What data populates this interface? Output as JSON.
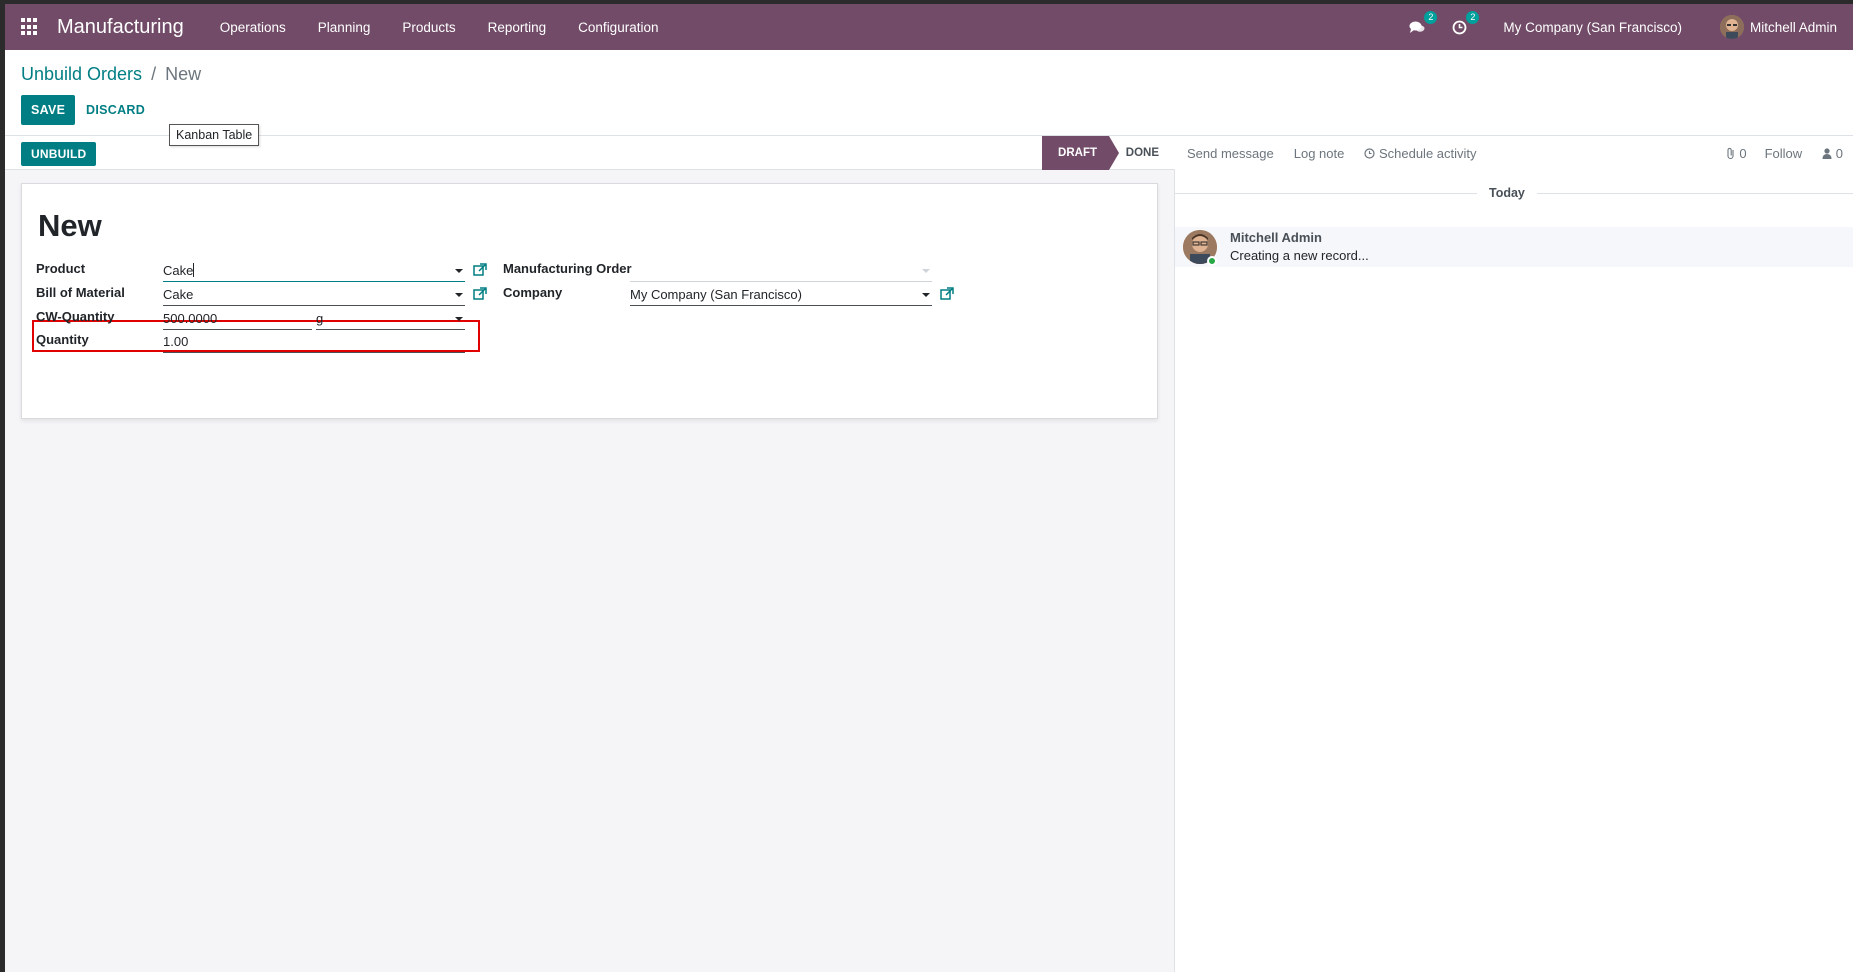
{
  "navbar": {
    "app_name": "Manufacturing",
    "menu": [
      "Operations",
      "Planning",
      "Products",
      "Reporting",
      "Configuration"
    ],
    "messages_badge": "2",
    "activities_badge": "2",
    "company": "My Company (San Francisco)",
    "user": "Mitchell Admin",
    "color": "#714B67"
  },
  "breadcrumb": {
    "parent": "Unbuild Orders",
    "separator": "/",
    "current": "New"
  },
  "buttons": {
    "save": "SAVE",
    "discard": "DISCARD",
    "unbuild": "UNBUILD"
  },
  "tooltip": "Kanban Table",
  "statusbar": {
    "stages": [
      "DRAFT",
      "DONE"
    ],
    "active": "DRAFT"
  },
  "form": {
    "title": "New",
    "product_label": "Product",
    "product_value": "Cake",
    "bom_label": "Bill of Material",
    "bom_value": "Cake",
    "cw_label": "CW-Quantity",
    "cw_value": "500.0000",
    "cw_uom": "g",
    "qty_label": "Quantity",
    "qty_value": "1.00",
    "mo_label": "Manufacturing Order",
    "mo_value": "",
    "company_label": "Company",
    "company_value": "My Company (San Francisco)"
  },
  "chatter": {
    "send_message": "Send message",
    "log_note": "Log note",
    "schedule_activity": "Schedule activity",
    "attachments_count": "0",
    "follow": "Follow",
    "followers_count": "0",
    "today": "Today",
    "author": "Mitchell Admin",
    "body": "Creating a new record..."
  },
  "colors": {
    "primary": "#017e84",
    "highlight": "#e00000"
  }
}
